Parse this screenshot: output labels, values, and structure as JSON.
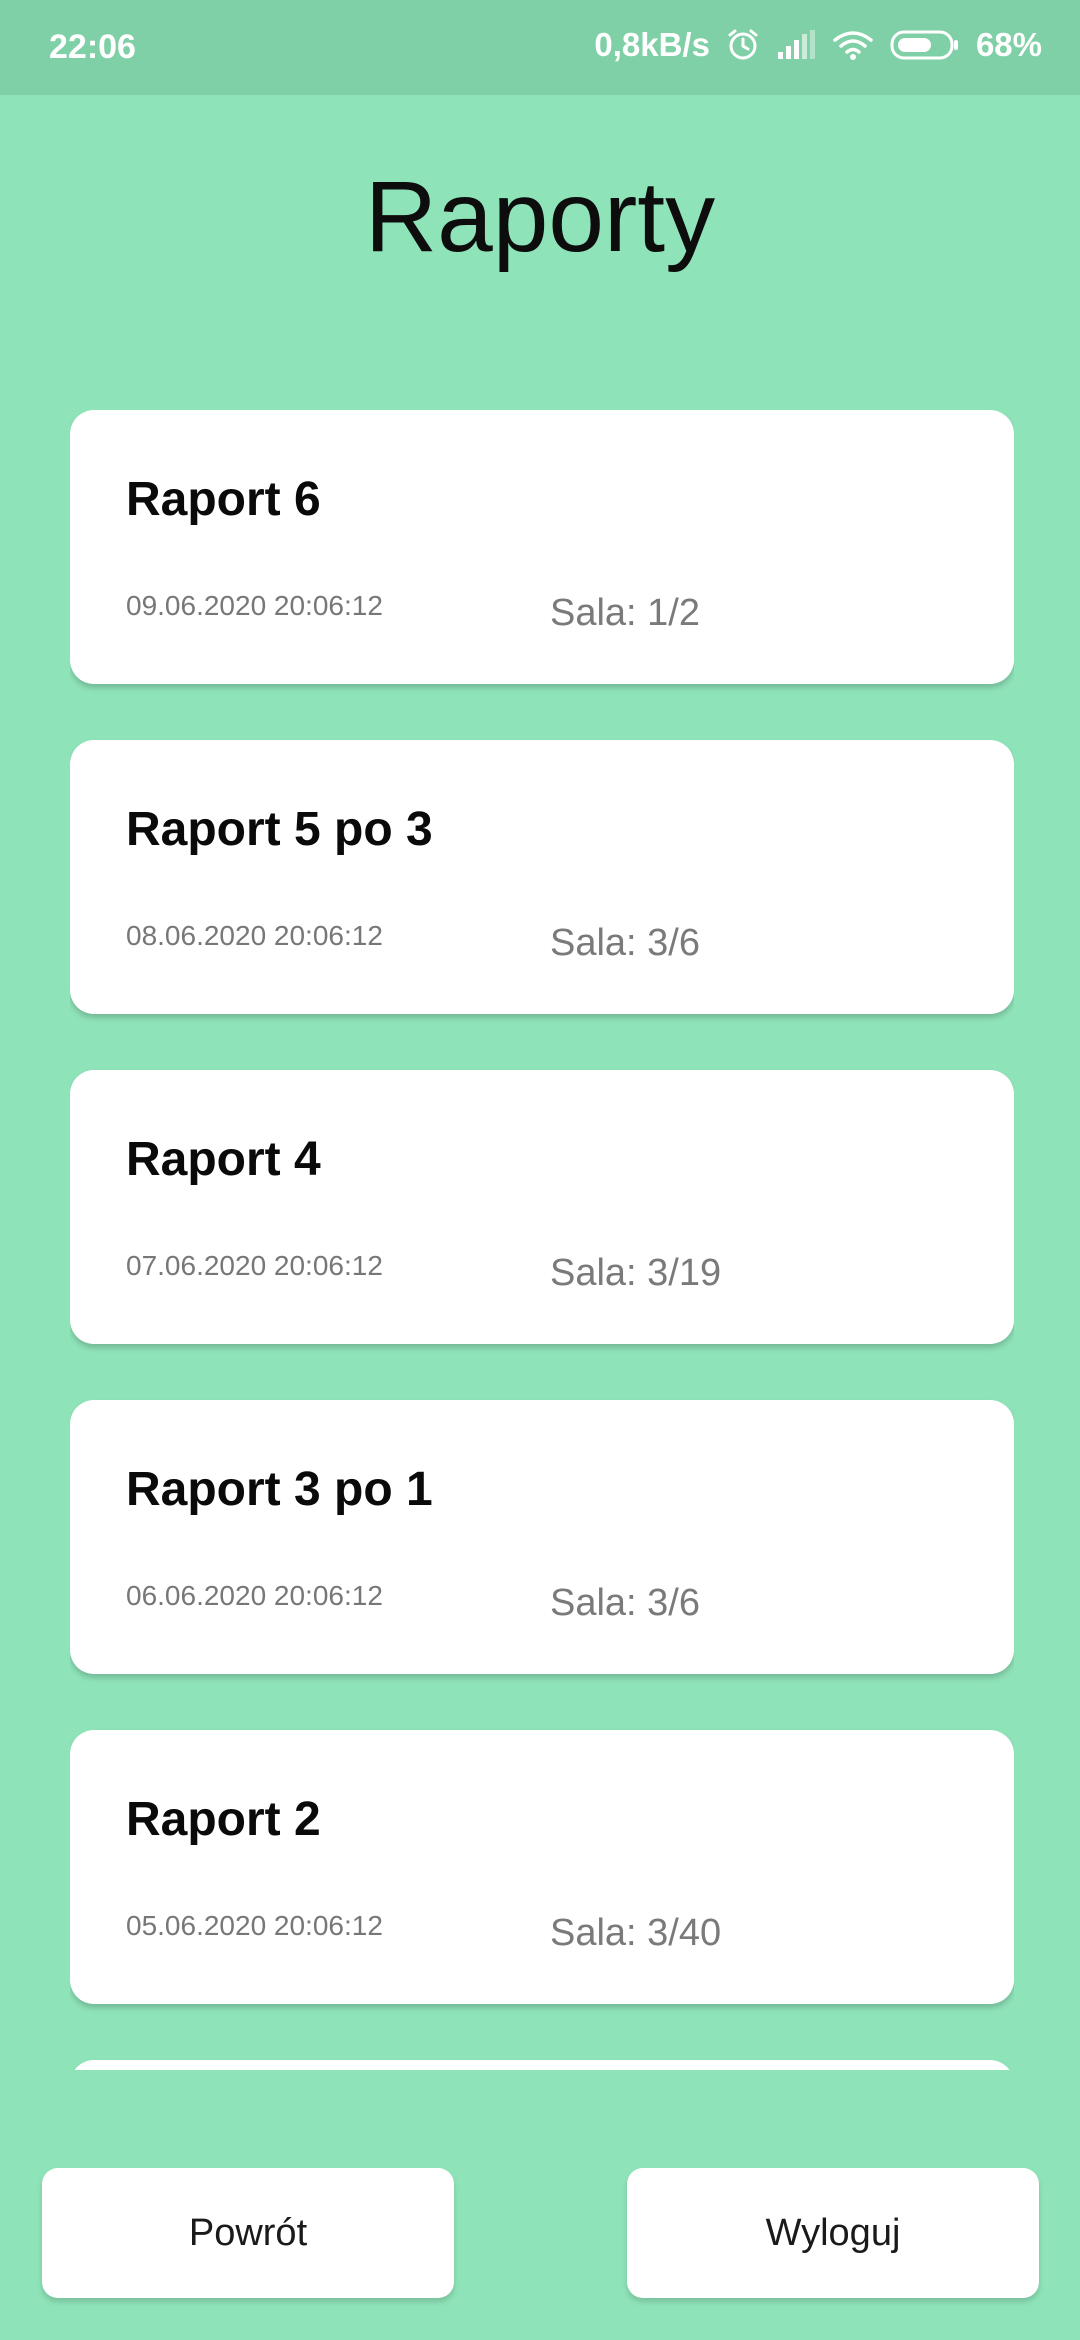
{
  "status_bar": {
    "time": "22:06",
    "network_speed": "0,8kB/s",
    "battery_percent": "68%",
    "battery_level": 0.68,
    "icons": [
      "alarm-icon",
      "signal-icon",
      "wifi-icon",
      "battery-icon"
    ]
  },
  "page": {
    "title": "Raporty"
  },
  "reports": [
    {
      "title": "Raport 6",
      "date": "09.06.2020 20:06:12",
      "room": "Sala: 1/2"
    },
    {
      "title": "Raport 5 po 3",
      "date": "08.06.2020 20:06:12",
      "room": "Sala: 3/6"
    },
    {
      "title": "Raport 4",
      "date": "07.06.2020 20:06:12",
      "room": "Sala: 3/19"
    },
    {
      "title": "Raport 3 po 1",
      "date": "06.06.2020 20:06:12",
      "room": "Sala: 3/6"
    },
    {
      "title": "Raport 2",
      "date": "05.06.2020 20:06:12",
      "room": "Sala: 3/40"
    }
  ],
  "buttons": {
    "back_label": "Powrót",
    "logout_label": "Wyloguj"
  },
  "colors": {
    "background": "#8fe3b9",
    "status_bar": "#7fd0a6",
    "card": "#ffffff"
  }
}
